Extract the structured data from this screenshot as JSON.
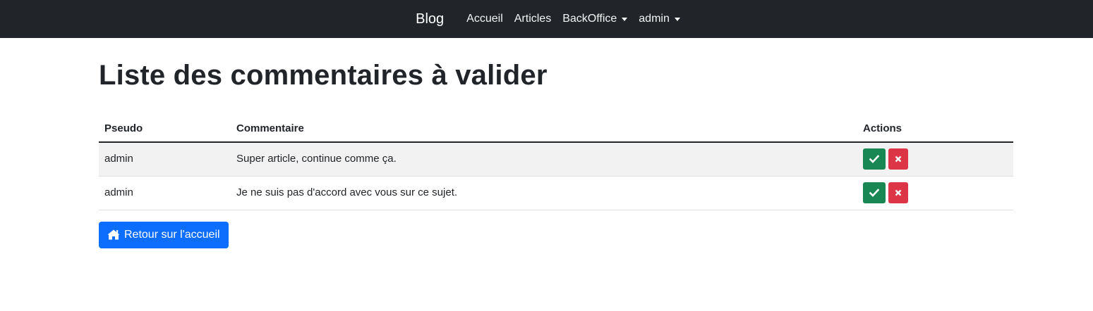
{
  "navbar": {
    "brand": "Blog",
    "links": [
      "Accueil",
      "Articles"
    ],
    "dropdowns": [
      "BackOffice",
      "admin"
    ]
  },
  "page": {
    "title": "Liste des commentaires à valider"
  },
  "table": {
    "headers": [
      "Pseudo",
      "Commentaire",
      "Actions"
    ],
    "rows": [
      {
        "pseudo": "admin",
        "comment": "Super article, continue comme ça."
      },
      {
        "pseudo": "admin",
        "comment": "Je ne suis pas d'accord avec vous sur ce sujet."
      }
    ]
  },
  "back_button": {
    "label": "Retour sur l'accueil",
    "icon": "home-icon"
  },
  "colors": {
    "navbar": "#212529",
    "validate": "#198754",
    "reject": "#dc3545",
    "primary": "#0d6efd"
  }
}
